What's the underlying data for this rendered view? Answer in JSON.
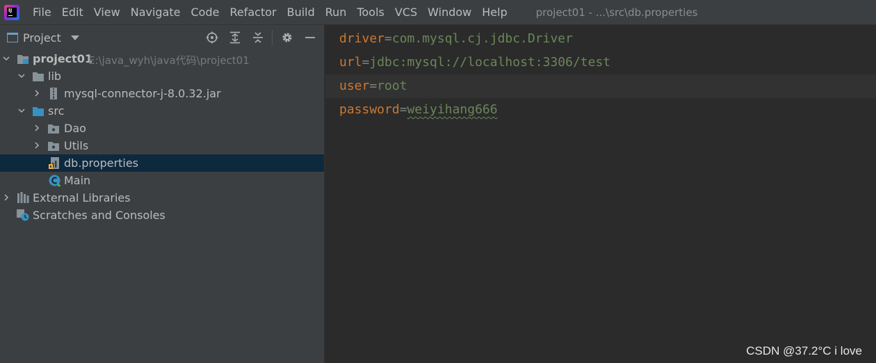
{
  "menubar": {
    "items": [
      {
        "label": "File"
      },
      {
        "label": "Edit"
      },
      {
        "label": "View"
      },
      {
        "label": "Navigate"
      },
      {
        "label": "Code"
      },
      {
        "label": "Refactor"
      },
      {
        "label": "Build"
      },
      {
        "label": "Run"
      },
      {
        "label": "Tools"
      },
      {
        "label": "VCS"
      },
      {
        "label": "Window"
      },
      {
        "label": "Help"
      }
    ],
    "window_title": "project01 - ...\\src\\db.properties"
  },
  "project_panel": {
    "title": "Project",
    "toolbar_icons": [
      "locate-icon",
      "expand-all-icon",
      "collapse-all-icon",
      "gear-icon",
      "minimize-icon"
    ],
    "tree": {
      "root": {
        "label": "project01",
        "path": "E:\\java_wyh\\java代码\\project01"
      },
      "lib": {
        "label": "lib"
      },
      "jar": {
        "label": "mysql-connector-j-8.0.32.jar"
      },
      "src": {
        "label": "src"
      },
      "dao": {
        "label": "Dao"
      },
      "utils": {
        "label": "Utils"
      },
      "dbprops": {
        "label": "db.properties"
      },
      "main": {
        "label": "Main"
      },
      "external": {
        "label": "External Libraries"
      },
      "scratches": {
        "label": "Scratches and Consoles"
      }
    }
  },
  "editor": {
    "lines": [
      {
        "key": "driver",
        "sep": "=",
        "value": "com.mysql.cj.jdbc.Driver"
      },
      {
        "key": "url",
        "sep": "=",
        "value": "jdbc:mysql://localhost:3306/test"
      },
      {
        "key": "user",
        "sep": "=",
        "value": "root"
      },
      {
        "key": "password",
        "sep": "=",
        "value": "weiyihang666"
      }
    ]
  },
  "colors": {
    "key": "#cc7832",
    "value": "#6a8759",
    "selection": "#0d293e",
    "panel_bg": "#3c3f41",
    "editor_bg": "#2b2b2b"
  },
  "watermark": "CSDN @37.2°C i love"
}
